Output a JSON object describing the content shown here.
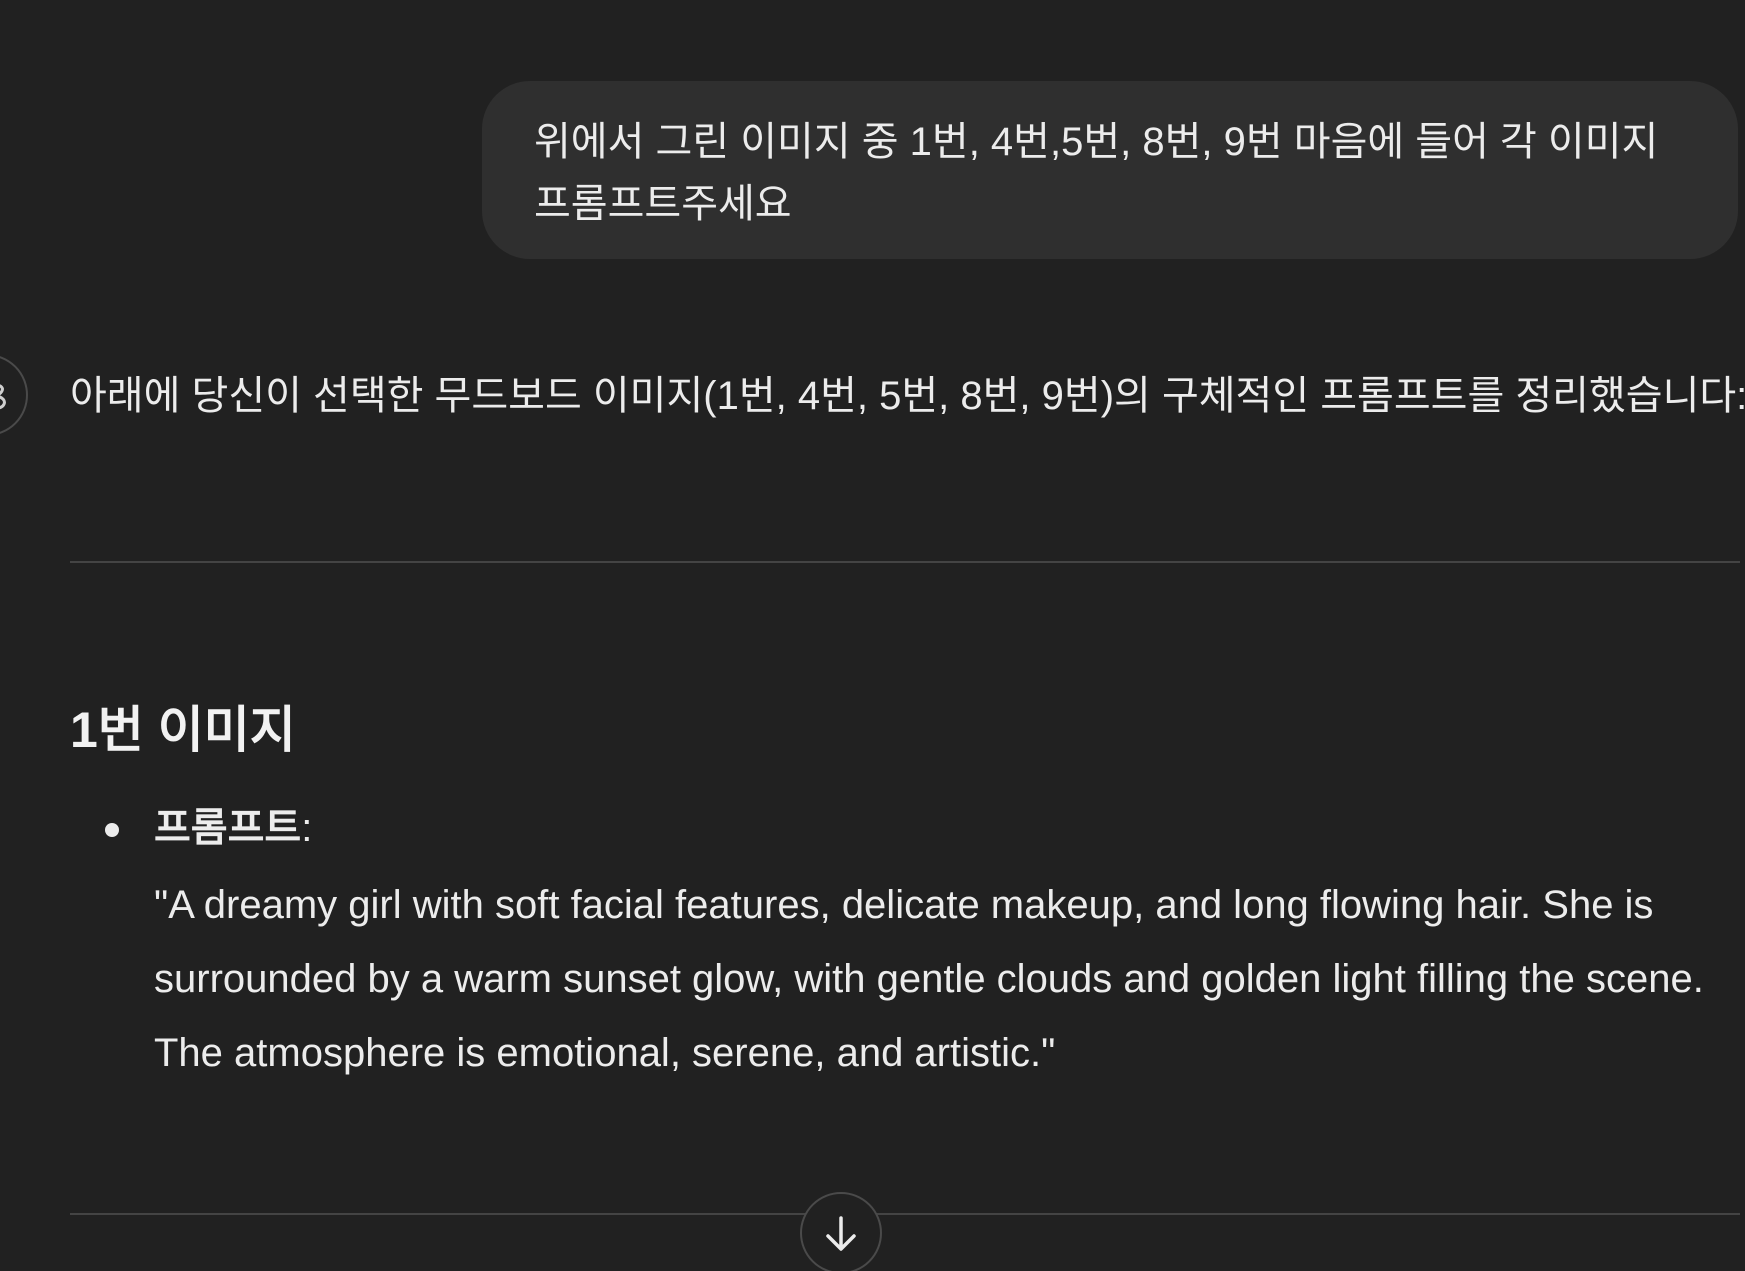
{
  "conversation": {
    "user_message": "위에서 그린 이미지 중 1번, 4번,5번, 8번, 9번 마음에 들어 각 이미지 프롬프트주세요",
    "assistant": {
      "intro": "아래에 당신이 선택한 무드보드 이미지(1번, 4번, 5번, 8번, 9번)의 구체적인 프롬프트를 정리했습니다:",
      "sections": [
        {
          "heading": "1번 이미지",
          "bullet_label": "프롬프트",
          "bullet_colon": ":",
          "prompt": "\"A dreamy girl with soft facial features, delicate makeup, and long flowing hair. She is surrounded by a warm sunset glow, with gentle clouds and golden light filling the scene. The atmosphere is emotional, serene, and artistic.\""
        }
      ]
    }
  },
  "icons": {
    "assistant_avatar": "assistant-logo-icon",
    "scroll_down": "arrow-down-icon"
  },
  "colors": {
    "background": "#212121",
    "user_bubble": "#2f2f2f",
    "text": "#ececec",
    "divider": "#444444"
  }
}
